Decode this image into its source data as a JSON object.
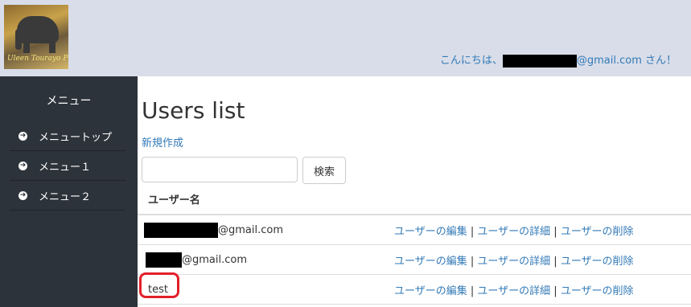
{
  "header": {
    "logo_text": "Uleen Tourayo Project",
    "greeting_prefix": "こんにちは、",
    "greeting_suffix": "@gmail.com さん！"
  },
  "sidebar": {
    "title": "メニュー",
    "items": [
      {
        "label": "メニュートップ"
      },
      {
        "label": "メニュー１"
      },
      {
        "label": "メニュー２"
      }
    ]
  },
  "main": {
    "title": "Users list",
    "new_link": "新規作成",
    "search": {
      "value": "",
      "button": "検索"
    },
    "table": {
      "header": "ユーザー名",
      "rows": [
        {
          "name_suffix": "@gmail.com",
          "edit": "ユーザーの編集",
          "detail": "ユーザーの詳細",
          "delete": "ユーザーの削除"
        },
        {
          "name_suffix": "@gmail.com",
          "edit": "ユーザーの編集",
          "detail": "ユーザーの詳細",
          "delete": "ユーザーの削除"
        },
        {
          "name": "test",
          "edit": "ユーザーの編集",
          "detail": "ユーザーの詳細",
          "delete": "ユーザーの削除"
        }
      ],
      "separator": " | "
    }
  },
  "colors": {
    "header_bg": "#d8dde9",
    "sidebar_bg": "#2d333b",
    "link": "#337ab7",
    "highlight": "#e2202a"
  }
}
